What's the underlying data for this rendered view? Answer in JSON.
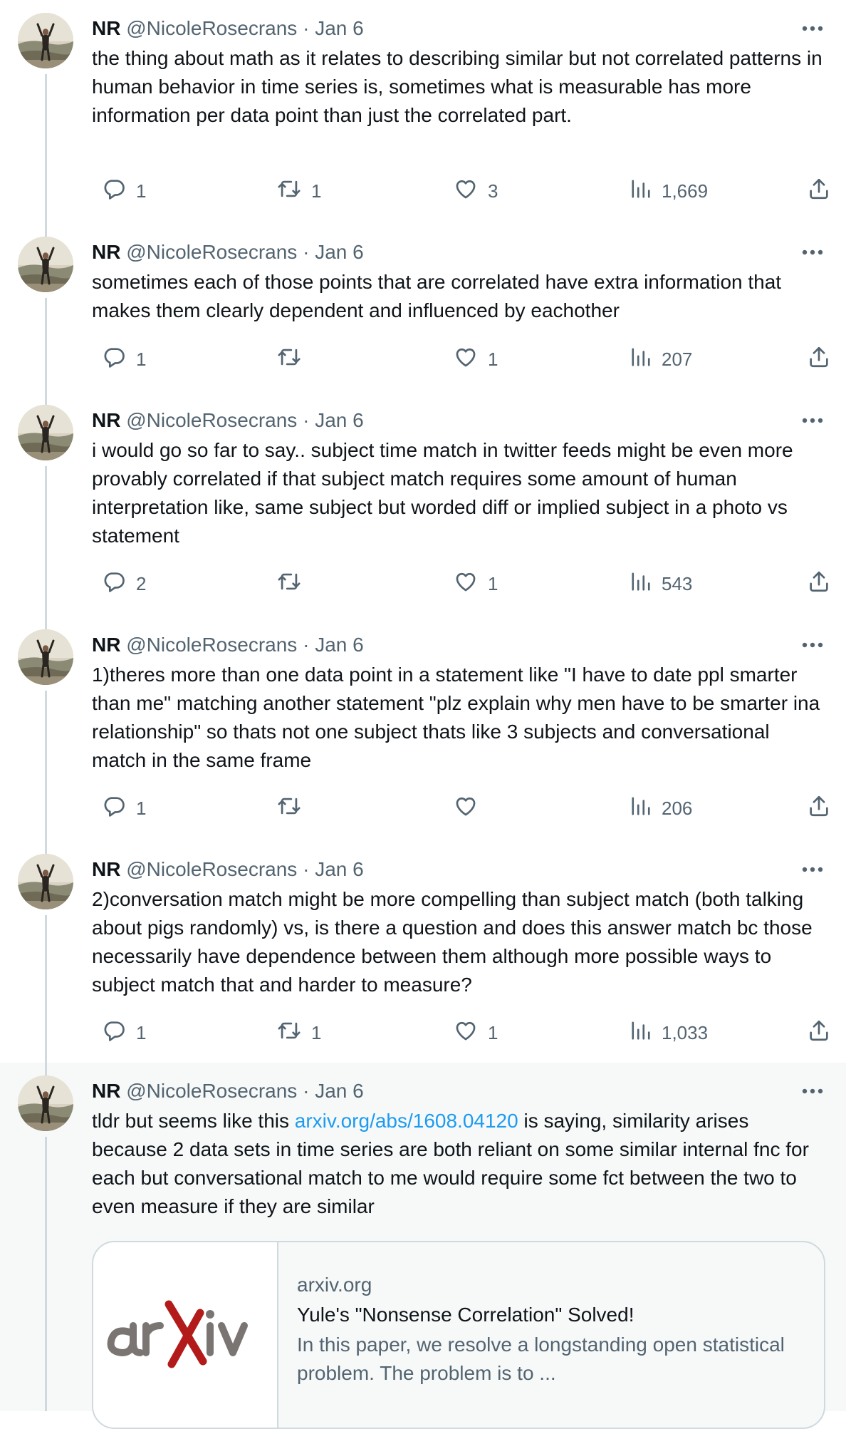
{
  "tweets": [
    {
      "name": "NR",
      "handle": "@NicoleRosecrans",
      "separator": "·",
      "date": "Jan 6",
      "text": "the thing about math as it relates to describing similar but not correlated patterns in human behavior in time series is, sometimes what is measurable has more information per data point than just the correlated part.",
      "replies": "1",
      "retweets": "1",
      "likes": "3",
      "views": "1,669"
    },
    {
      "name": "NR",
      "handle": "@NicoleRosecrans",
      "separator": "·",
      "date": "Jan 6",
      "text": "sometimes each of those points that are correlated have extra information that makes them clearly dependent and influenced by eachother",
      "replies": "1",
      "retweets": "",
      "likes": "1",
      "views": "207"
    },
    {
      "name": "NR",
      "handle": "@NicoleRosecrans",
      "separator": "·",
      "date": "Jan 6",
      "text": "i would go so far to say.. subject time match in twitter feeds might be even more provably correlated if that subject match requires some amount of human interpretation like, same subject but worded diff or implied subject in a photo vs statement",
      "replies": "2",
      "retweets": "",
      "likes": "1",
      "views": "543"
    },
    {
      "name": "NR",
      "handle": "@NicoleRosecrans",
      "separator": "·",
      "date": "Jan 6",
      "text": "1)theres more than one data point in a statement like \"I have to date ppl smarter than me\" matching another statement \"plz explain why men have to be smarter ina relationship\" so thats not one subject thats like 3 subjects and conversational match in the same frame",
      "replies": "1",
      "retweets": "",
      "likes": "",
      "views": "206"
    },
    {
      "name": "NR",
      "handle": "@NicoleRosecrans",
      "separator": "·",
      "date": "Jan 6",
      "text": "2)conversation match might be more compelling than subject match (both talking about pigs randomly) vs, is there a question and does this answer match bc those necessarily have dependence between them although more possible ways to subject match that and harder to measure?",
      "replies": "1",
      "retweets": "1",
      "likes": "1",
      "views": "1,033"
    },
    {
      "name": "NR",
      "handle": "@NicoleRosecrans",
      "separator": "·",
      "date": "Jan 6",
      "text_before": "tldr but seems like this ",
      "link": "arxiv.org/abs/1608.04120",
      "text_after": " is saying, similarity arises because 2 data sets in time series are both reliant on some similar internal fnc for each but conversational match to me would require some fct between the two to even measure if they are similar",
      "card": {
        "logo": "arXiv",
        "domain": "arxiv.org",
        "title": "Yule's \"Nonsense Correlation\" Solved!",
        "description": "In this paper, we resolve a longstanding open statistical problem. The problem is to ..."
      }
    }
  ],
  "icons": {
    "reply": "reply-icon",
    "retweet": "retweet-icon",
    "like": "like-icon",
    "views": "views-icon",
    "share": "share-icon",
    "more": "more-icon"
  },
  "colors": {
    "text": "#0f1419",
    "secondary": "#536471",
    "link": "#1d9bf0",
    "rail": "#cfd9de",
    "highlight_bg": "#f7f9f9"
  }
}
